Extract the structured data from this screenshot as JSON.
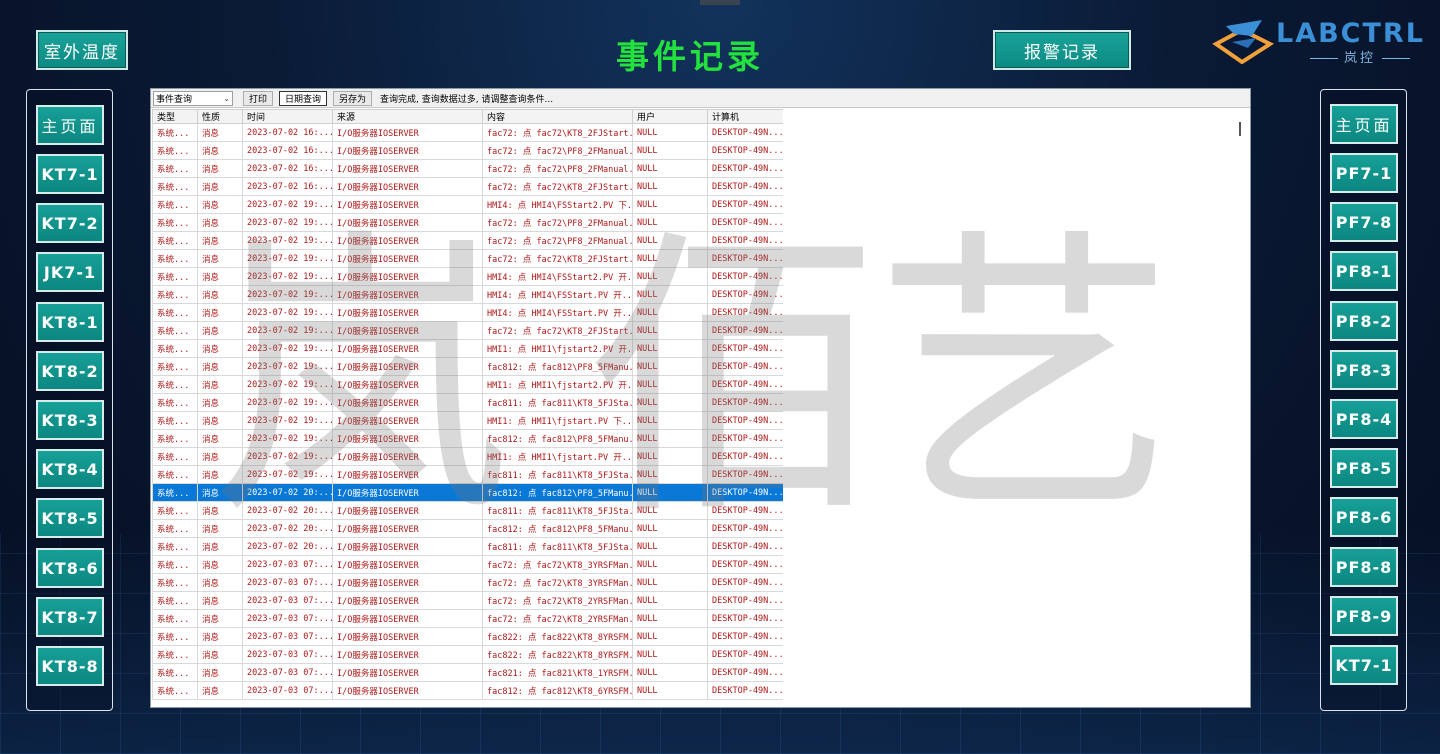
{
  "header": {
    "title": "事件记录",
    "outdoor_temp_btn": "室外温度",
    "alarm_records_btn": "报警记录"
  },
  "logo": {
    "name": "LABCTRL",
    "sub": "岚控",
    "colors": {
      "primary": "#3a8fd6",
      "accent": "#f2a03a"
    }
  },
  "left_nav": {
    "items": [
      "主页面",
      "KT7-1",
      "KT7-2",
      "JK7-1",
      "KT8-1",
      "KT8-2",
      "KT8-3",
      "KT8-4",
      "KT8-5",
      "KT8-6",
      "KT8-7",
      "KT8-8"
    ]
  },
  "right_nav": {
    "items": [
      "主页面",
      "PF7-1",
      "PF7-8",
      "PF8-1",
      "PF8-2",
      "PF8-3",
      "PF8-4",
      "PF8-5",
      "PF8-6",
      "PF8-8",
      "PF8-9",
      "KT7-1"
    ]
  },
  "toolbar": {
    "query_type": "事件查询",
    "print": "打印",
    "date_query": "日期查询",
    "save_as": "另存为",
    "status": "查询完成, 查询数据过多, 请调整查询条件..."
  },
  "table": {
    "columns": [
      "类型",
      "性质",
      "时间",
      "来源",
      "内容",
      "用户",
      "计算机"
    ],
    "rows": [
      [
        "系统...",
        "消息",
        "2023-07-02 16:...",
        "I/O服务器IOSERVER",
        "fac72: 点 fac72\\KT8_2FJStart...",
        "NULL",
        "DESKTOP-49N..."
      ],
      [
        "系统...",
        "消息",
        "2023-07-02 16:...",
        "I/O服务器IOSERVER",
        "fac72: 点 fac72\\PF8_2FManual...",
        "NULL",
        "DESKTOP-49N..."
      ],
      [
        "系统...",
        "消息",
        "2023-07-02 16:...",
        "I/O服务器IOSERVER",
        "fac72: 点 fac72\\PF8_2FManual...",
        "NULL",
        "DESKTOP-49N..."
      ],
      [
        "系统...",
        "消息",
        "2023-07-02 16:...",
        "I/O服务器IOSERVER",
        "fac72: 点 fac72\\KT8_2FJStart...",
        "NULL",
        "DESKTOP-49N..."
      ],
      [
        "系统...",
        "消息",
        "2023-07-02 19:...",
        "I/O服务器IOSERVER",
        "HMI4: 点 HMI4\\FSStart2.PV 下...",
        "NULL",
        "DESKTOP-49N..."
      ],
      [
        "系统...",
        "消息",
        "2023-07-02 19:...",
        "I/O服务器IOSERVER",
        "fac72: 点 fac72\\PF8_2FManual...",
        "NULL",
        "DESKTOP-49N..."
      ],
      [
        "系统...",
        "消息",
        "2023-07-02 19:...",
        "I/O服务器IOSERVER",
        "fac72: 点 fac72\\PF8_2FManual...",
        "NULL",
        "DESKTOP-49N..."
      ],
      [
        "系统...",
        "消息",
        "2023-07-02 19:...",
        "I/O服务器IOSERVER",
        "fac72: 点 fac72\\KT8_2FJStart...",
        "NULL",
        "DESKTOP-49N..."
      ],
      [
        "系统...",
        "消息",
        "2023-07-02 19:...",
        "I/O服务器IOSERVER",
        "HMI4: 点 HMI4\\FSStart2.PV 开...",
        "NULL",
        "DESKTOP-49N..."
      ],
      [
        "系统...",
        "消息",
        "2023-07-02 19:...",
        "I/O服务器IOSERVER",
        "HMI4: 点 HMI4\\FSStart.PV 开...",
        "NULL",
        "DESKTOP-49N..."
      ],
      [
        "系统...",
        "消息",
        "2023-07-02 19:...",
        "I/O服务器IOSERVER",
        "HMI4: 点 HMI4\\FSStart.PV 开...",
        "NULL",
        "DESKTOP-49N..."
      ],
      [
        "系统...",
        "消息",
        "2023-07-02 19:...",
        "I/O服务器IOSERVER",
        "fac72: 点 fac72\\KT8_2FJStart...",
        "NULL",
        "DESKTOP-49N..."
      ],
      [
        "系统...",
        "消息",
        "2023-07-02 19:...",
        "I/O服务器IOSERVER",
        "HMI1: 点 HMI1\\fjstart2.PV 开...",
        "NULL",
        "DESKTOP-49N..."
      ],
      [
        "系统...",
        "消息",
        "2023-07-02 19:...",
        "I/O服务器IOSERVER",
        "fac812: 点 fac812\\PF8_5FManu...",
        "NULL",
        "DESKTOP-49N..."
      ],
      [
        "系统...",
        "消息",
        "2023-07-02 19:...",
        "I/O服务器IOSERVER",
        "HMI1: 点 HMI1\\fjstart2.PV 开...",
        "NULL",
        "DESKTOP-49N..."
      ],
      [
        "系统...",
        "消息",
        "2023-07-02 19:...",
        "I/O服务器IOSERVER",
        "fac811: 点 fac811\\KT8_5FJSta...",
        "NULL",
        "DESKTOP-49N..."
      ],
      [
        "系统...",
        "消息",
        "2023-07-02 19:...",
        "I/O服务器IOSERVER",
        "HMI1: 点 HMI1\\fjstart.PV 下...",
        "NULL",
        "DESKTOP-49N..."
      ],
      [
        "系统...",
        "消息",
        "2023-07-02 19:...",
        "I/O服务器IOSERVER",
        "fac812: 点 fac812\\PF8_5FManu...",
        "NULL",
        "DESKTOP-49N..."
      ],
      [
        "系统...",
        "消息",
        "2023-07-02 19:...",
        "I/O服务器IOSERVER",
        "HMI1: 点 HMI1\\fjstart.PV 开...",
        "NULL",
        "DESKTOP-49N..."
      ],
      [
        "系统...",
        "消息",
        "2023-07-02 19:...",
        "I/O服务器IOSERVER",
        "fac811: 点 fac811\\KT8_5FJSta...",
        "NULL",
        "DESKTOP-49N..."
      ],
      [
        "系统...",
        "消息",
        "2023-07-02 20:...",
        "I/O服务器IOSERVER",
        "fac812: 点 fac812\\PF8_5FManu...",
        "NULL",
        "DESKTOP-49N..."
      ],
      [
        "系统...",
        "消息",
        "2023-07-02 20:...",
        "I/O服务器IOSERVER",
        "fac811: 点 fac811\\KT8_5FJSta...",
        "NULL",
        "DESKTOP-49N..."
      ],
      [
        "系统...",
        "消息",
        "2023-07-02 20:...",
        "I/O服务器IOSERVER",
        "fac812: 点 fac812\\PF8_5FManu...",
        "NULL",
        "DESKTOP-49N..."
      ],
      [
        "系统...",
        "消息",
        "2023-07-02 20:...",
        "I/O服务器IOSERVER",
        "fac811: 点 fac811\\KT8_5FJSta...",
        "NULL",
        "DESKTOP-49N..."
      ],
      [
        "系统...",
        "消息",
        "2023-07-03 07:...",
        "I/O服务器IOSERVER",
        "fac72: 点 fac72\\KT8_3YRSFMan...",
        "NULL",
        "DESKTOP-49N..."
      ],
      [
        "系统...",
        "消息",
        "2023-07-03 07:...",
        "I/O服务器IOSERVER",
        "fac72: 点 fac72\\KT8_3YRSFMan...",
        "NULL",
        "DESKTOP-49N..."
      ],
      [
        "系统...",
        "消息",
        "2023-07-03 07:...",
        "I/O服务器IOSERVER",
        "fac72: 点 fac72\\KT8_2YRSFMan...",
        "NULL",
        "DESKTOP-49N..."
      ],
      [
        "系统...",
        "消息",
        "2023-07-03 07:...",
        "I/O服务器IOSERVER",
        "fac72: 点 fac72\\KT8_2YRSFMan...",
        "NULL",
        "DESKTOP-49N..."
      ],
      [
        "系统...",
        "消息",
        "2023-07-03 07:...",
        "I/O服务器IOSERVER",
        "fac822: 点 fac822\\KT8_8YRSFM...",
        "NULL",
        "DESKTOP-49N..."
      ],
      [
        "系统...",
        "消息",
        "2023-07-03 07:...",
        "I/O服务器IOSERVER",
        "fac822: 点 fac822\\KT8_8YRSFM...",
        "NULL",
        "DESKTOP-49N..."
      ],
      [
        "系统...",
        "消息",
        "2023-07-03 07:...",
        "I/O服务器IOSERVER",
        "fac821: 点 fac821\\KT8_1YRSFM...",
        "NULL",
        "DESKTOP-49N..."
      ],
      [
        "系统...",
        "消息",
        "2023-07-03 07:...",
        "I/O服务器IOSERVER",
        "fac812: 点 fac812\\KT8_6YRSFM...",
        "NULL",
        "DESKTOP-49N..."
      ]
    ],
    "selected_row": 20
  },
  "watermark": "岚 佰艺",
  "colors": {
    "button_teal": "#0c8a82",
    "title_green": "#23e23e",
    "row_text": "#b01818",
    "selection": "#0a78d7"
  }
}
